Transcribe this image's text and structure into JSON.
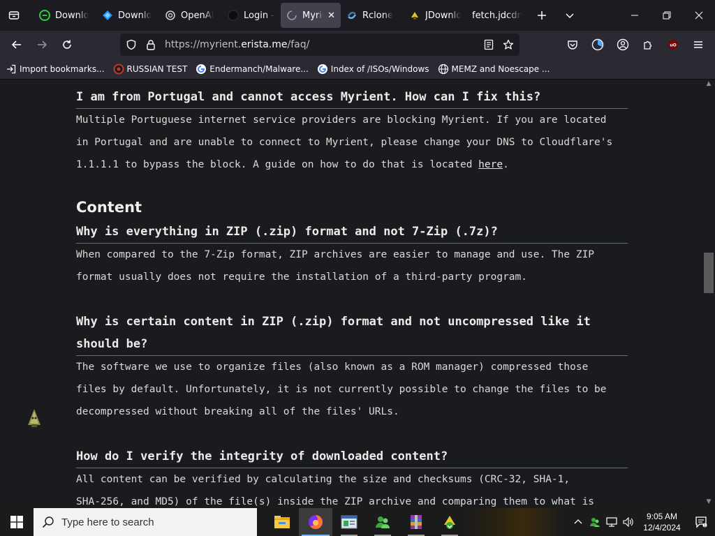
{
  "browser": {
    "tabs": [
      {
        "label": "Downlo",
        "favicon": "green-circle-icon",
        "color": "#2ecc40",
        "active": false
      },
      {
        "label": "Downlo",
        "favicon": "blue-diamond-icon",
        "color": "#1e90ff",
        "active": false
      },
      {
        "label": "OpenAI",
        "favicon": "openai-icon",
        "color": "#d0d0d0",
        "active": false
      },
      {
        "label": "Login - C",
        "favicon": "dark-circle-icon",
        "color": "#111111",
        "active": false
      },
      {
        "label": "Myrie",
        "favicon": "loading-icon",
        "color": "#9a9aa5",
        "active": true
      },
      {
        "label": "Rclone",
        "favicon": "rclone-icon",
        "color": "#3f79ad",
        "active": false
      },
      {
        "label": "JDownlo",
        "favicon": "jdownloader-icon",
        "color": "#e6c229",
        "active": false
      },
      {
        "label": "fetch.jdcdn.c",
        "favicon": "",
        "color": "",
        "active": false
      }
    ],
    "close_glyph": "✕",
    "url_scheme": "https://myrient.",
    "url_host": "erista.me",
    "url_path": "/faq/",
    "bookmarks": [
      {
        "label": "Import bookmarks...",
        "icon": "import-icon"
      },
      {
        "label": "RUSSIAN TEST",
        "icon": "russian-test-icon"
      },
      {
        "label": "Endermanch/Malware...",
        "icon": "google-icon"
      },
      {
        "label": "Index of /ISOs/Windows",
        "icon": "google-icon"
      },
      {
        "label": "MEMZ and Noescape ...",
        "icon": "globe-icon"
      }
    ]
  },
  "page": {
    "q_portugal": "I am from Portugal and cannot access Myrient. How can I fix this?",
    "p_portugal_1": "Multiple Portuguese internet service providers are blocking Myrient. If you are located",
    "p_portugal_2": "in Portugal and are unable to connect to Myrient, please change your DNS to Cloudflare's",
    "p_portugal_3_pre": "1.1.1.1 to bypass the block. A guide on how to do that is located ",
    "p_portugal_link": "here",
    "p_portugal_3_post": ".",
    "h_content": "Content",
    "q_zip": "Why is everything in ZIP (.zip) format and not 7-Zip (.7z)?",
    "p_zip_1": "When compared to the 7-Zip format, ZIP archives are easier to manage and use. The ZIP",
    "p_zip_2": "format usually does not require the installation of a third-party program.",
    "q_uncompressed_1": "Why is certain content in ZIP (.zip) format and not uncompressed like it",
    "q_uncompressed_2": "should be?",
    "p_unc_1": "The software we use to organize files (also known as a ROM manager) compressed those",
    "p_unc_2": "files by default. Unfortunately, it is not currently possible to change the files to be",
    "p_unc_3": "decompressed without breaking all of the files' URLs.",
    "q_verify": "How do I verify the integrity of downloaded content?",
    "p_verify_1": "All content can be verified by calculating the size and checksums (CRC-32, SHA-1,",
    "p_verify_2": "SHA-256, and MD5) of the file(s) inside the ZIP archive and comparing them to what is"
  },
  "taskbar": {
    "search_placeholder": "Type here to search",
    "time": "9:05 AM",
    "date": "12/4/2024",
    "apps": [
      "file-explorer-icon",
      "firefox-icon",
      "app-window-icon",
      "green-people-icon",
      "winrar-icon",
      "jdownloader-icon"
    ]
  },
  "colors": {
    "page_bg": "#191b1f",
    "chrome_bg": "#1c1b22",
    "toolbar_bg": "#2b2a33",
    "active_tab": "#42414d"
  }
}
